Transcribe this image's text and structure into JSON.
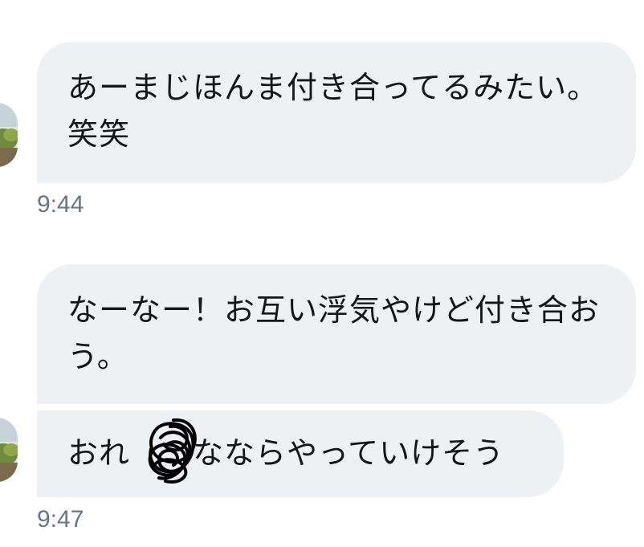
{
  "conversation": {
    "messages": [
      {
        "text": "あーまじほんま付き合ってるみたい。笑笑"
      },
      {
        "text": "なーなー！お互い浮気やけど付き合おう。"
      },
      {
        "text": "おれ　　なならやっていけそう"
      }
    ],
    "timestamps": [
      "9:44",
      "9:47"
    ]
  },
  "colors": {
    "bubble_bg": "#eef1f4",
    "text": "#14171a",
    "timestamp": "#657786",
    "scribble": "#000000"
  },
  "icons": [
    "avatar",
    "redaction-scribble"
  ]
}
